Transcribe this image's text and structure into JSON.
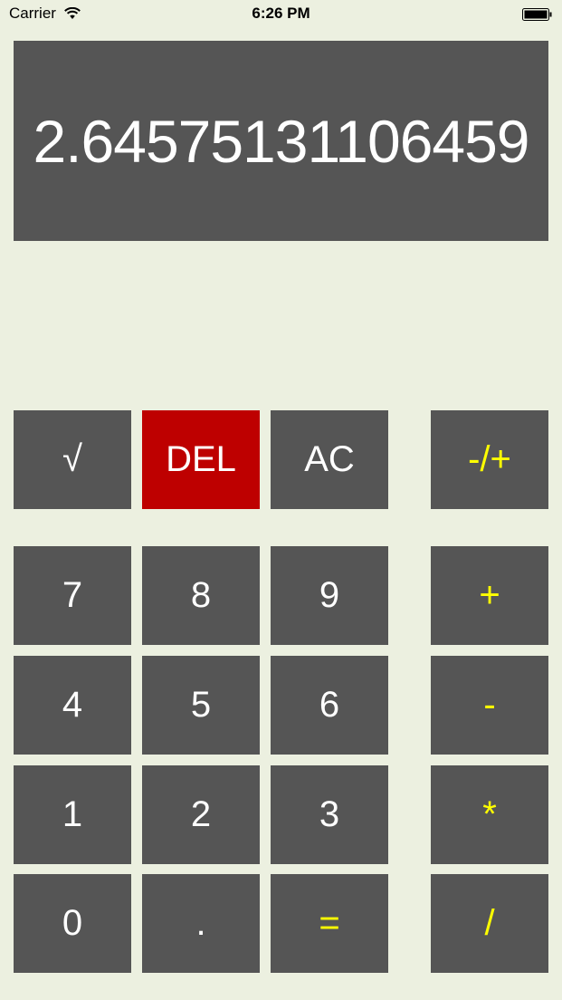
{
  "status_bar": {
    "carrier": "Carrier",
    "time": "6:26 PM"
  },
  "display": {
    "value": "2.64575131106459"
  },
  "keys": {
    "sqrt": "√",
    "del": "DEL",
    "ac": "AC",
    "negate": "-/+",
    "seven": "7",
    "eight": "8",
    "nine": "9",
    "plus": "+",
    "four": "4",
    "five": "5",
    "six": "6",
    "minus": "-",
    "one": "1",
    "two": "2",
    "three": "3",
    "multiply": "*",
    "zero": "0",
    "decimal": ".",
    "equals": "=",
    "divide": "/"
  },
  "colors": {
    "background": "#ECF0E0",
    "key": "#555555",
    "key_text": "#FFFFFF",
    "operator_text": "#FFFF00",
    "delete_key": "#BE0000"
  }
}
